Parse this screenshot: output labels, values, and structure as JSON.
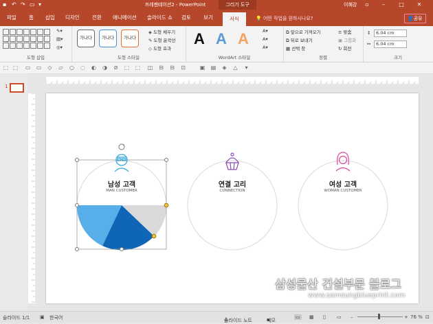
{
  "titlebar": {
    "document_title": "프레젠테이션2 - PowerPoint",
    "context_tool": "그리기 도구",
    "user": "이혜강"
  },
  "tabs": [
    "파일",
    "홈",
    "삽입",
    "디자인",
    "전환",
    "애니메이션",
    "슬라이드 쇼",
    "검토",
    "보기",
    "서식"
  ],
  "active_tab": "서식",
  "tell_me": "어떤 작업을 원하시나요?",
  "share": "공유",
  "ribbon": {
    "groups": [
      "도형 삽입",
      "도형 스타일",
      "WordArt 스타일",
      "정렬",
      "크기"
    ],
    "style_presets": [
      "가나다",
      "가나다",
      "가나다"
    ],
    "shape_fill": "도형 채우기",
    "shape_outline": "도형 윤곽선",
    "shape_effects": "도형 효과",
    "wordart_letters": [
      "A",
      "A",
      "A"
    ],
    "bring_forward": "앞으로 가져오기",
    "send_backward": "뒤로 보내기",
    "selection_pane": "선택 창",
    "align": "맞춤",
    "group": "그룹화",
    "rotate": "회전",
    "height": "6.04 cm",
    "width": "6.04 cm"
  },
  "colors": {
    "accent": "#b7472a",
    "pie_light": "#58aee8",
    "pie_dark": "#0f66b6",
    "pie_gray": "#d9d9d9",
    "icon_blue": "#29a3d8",
    "icon_purple": "#8a4bb0",
    "icon_pink": "#e0449a"
  },
  "slide": {
    "thumb_number": "1",
    "circles": [
      {
        "title": "남성 고객",
        "subtitle": "MAN CUSTOMER",
        "icon": "man-icon"
      },
      {
        "title": "연결 고리",
        "subtitle": "CONNECTION",
        "icon": "cupcake-icon"
      },
      {
        "title": "여성 고객",
        "subtitle": "WOMAN CUSTOMER",
        "icon": "woman-icon"
      }
    ],
    "watermark_title": "삼성물산 건설부문 블로그",
    "watermark_url": "www.samsungblueprint.com"
  },
  "statusbar": {
    "slide_counter": "슬라이드 1/1",
    "language": "한국어",
    "notes": "슬라이드 노트",
    "comments": "메모",
    "zoom": "76 %"
  }
}
